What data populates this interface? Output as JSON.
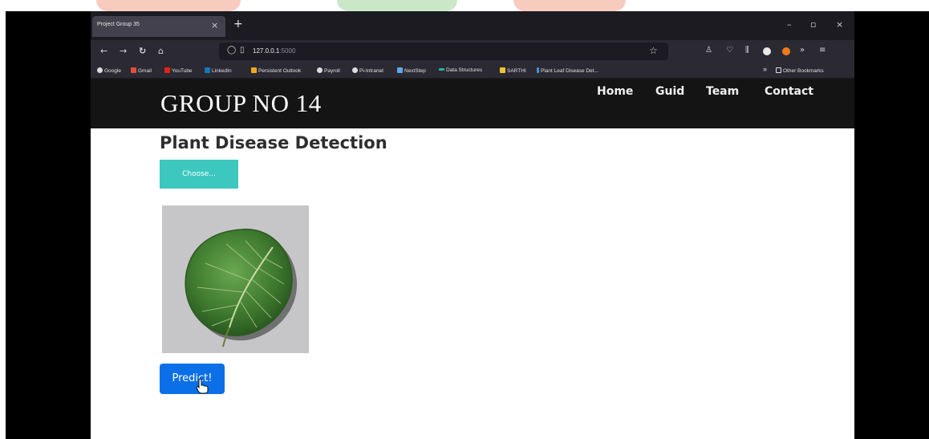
{
  "browser": {
    "tab_title": "Project Group 35",
    "tab_close": "×",
    "new_tab": "+",
    "window_controls": [
      "–",
      "▫",
      "×"
    ],
    "url_host": "127.0.0.1",
    "url_port": ":5000",
    "bookmarks": [
      "Google",
      "Gmail",
      "YouTube",
      "LinkedIn",
      "Persistent Outlook",
      "Payroll",
      "Pi-Intranet",
      "NextStep",
      "Data Structures",
      "SARTHI",
      "Plant Leaf Disease Det..."
    ],
    "bookmarks_overflow": "»",
    "other_bookmarks": "Other Bookmarks"
  },
  "site": {
    "brand": "GROUP NO 14",
    "nav": [
      "Home",
      "Guid",
      "Team",
      "Contact"
    ]
  },
  "main": {
    "title": "Plant Disease Detection",
    "choose_label": "Choose...",
    "predict_label": "Predict!"
  },
  "colors": {
    "accent_teal": "#3cc8be",
    "predict_blue": "#0b6fe8",
    "header_bg": "#141414"
  }
}
